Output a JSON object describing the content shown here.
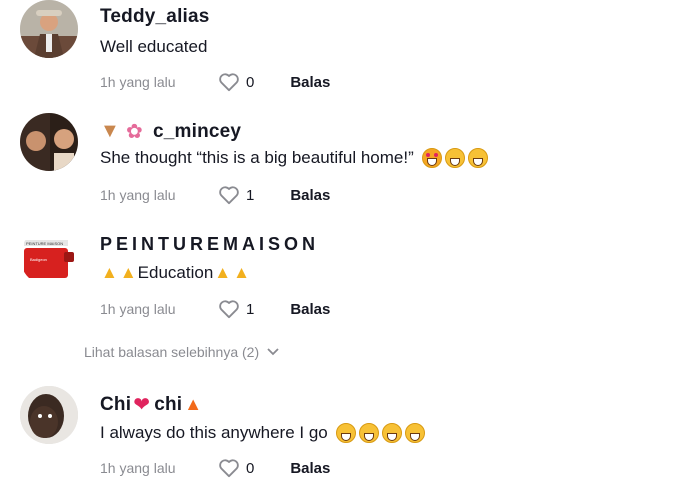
{
  "comments": [
    {
      "username": "Teddy_alias",
      "text": "Well educated",
      "time": "1h yang lalu",
      "likes": "0",
      "reply": "Balas"
    },
    {
      "username": "c_mincey",
      "text": "She thought “this is a big beautiful home!”",
      "time": "1h yang lalu",
      "likes": "1",
      "reply": "Balas"
    },
    {
      "username": "PEINTUREMAISON",
      "text_before": "",
      "text_main": "Education",
      "time": "1h yang lalu",
      "likes": "1",
      "reply": "Balas",
      "avatar_text_1": "PEINTURE MAISON",
      "avatar_text_2": "Badigeon"
    },
    {
      "username_part1": "Chi",
      "username_part2": "chi",
      "text": "I always do this anywhere I go",
      "time": "1h yang lalu",
      "likes": "0",
      "reply": "Balas"
    }
  ],
  "more_replies": "Lihat balasan selebihnya (2)",
  "icons": {
    "like": "heart-outline-icon",
    "expand": "chevron-down-icon"
  }
}
